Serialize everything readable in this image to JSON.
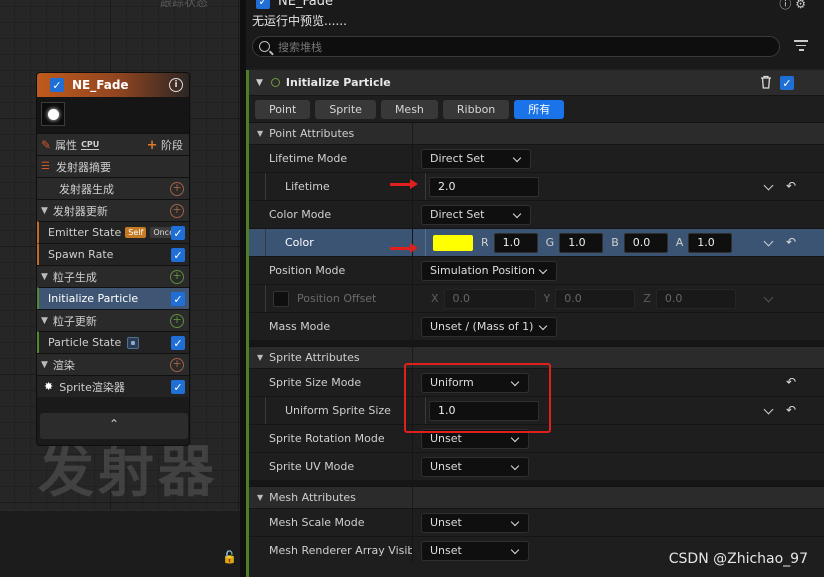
{
  "graph": {
    "top_clipped_text": "跟踪状态",
    "watermark": "发射器",
    "node": {
      "title": "NE_Fade",
      "checked": true,
      "props_label": "属性",
      "cpu_badge": "CPU",
      "stage_label": "阶段",
      "rows": [
        {
          "kind": "section",
          "label": "发射器摘要",
          "icon": "list-icon"
        },
        {
          "kind": "subsection",
          "label": "发射器生成",
          "plus": "orange"
        },
        {
          "kind": "section",
          "label": "发射器更新",
          "plus": "orange"
        },
        {
          "kind": "module",
          "label": "Emitter State",
          "badges": [
            "Self",
            "Once"
          ],
          "accent": "orange",
          "checked": true
        },
        {
          "kind": "module",
          "label": "Spawn Rate",
          "accent": "orange",
          "checked": true
        },
        {
          "kind": "section",
          "label": "粒子生成",
          "plus": "green"
        },
        {
          "kind": "module",
          "label": "Initialize Particle",
          "accent": "green",
          "checked": true,
          "selected": true
        },
        {
          "kind": "section",
          "label": "粒子更新",
          "plus": "green"
        },
        {
          "kind": "module",
          "label": "Particle State",
          "accent": "green",
          "checked": true
        },
        {
          "kind": "section",
          "label": "渲染",
          "plus": "orange"
        },
        {
          "kind": "module",
          "label": "Sprite渲染器",
          "accent": "none",
          "checked": true,
          "icon": "sprite-renderer-icon"
        }
      ]
    }
  },
  "panel": {
    "emitter_name": "NE_Fade",
    "preview_text": "无运行中预览......",
    "search_placeholder": "搜索堆栈",
    "module_title": "Initialize Particle",
    "tabs": [
      "Point",
      "Sprite",
      "Mesh",
      "Ribbon",
      "所有"
    ],
    "active_tab": "所有",
    "point_section": "Point Attributes",
    "lifetime_mode_label": "Lifetime Mode",
    "lifetime_mode_value": "Direct Set",
    "lifetime_label": "Lifetime",
    "lifetime_value": "2.0",
    "color_mode_label": "Color Mode",
    "color_mode_value": "Direct Set",
    "color_label": "Color",
    "color_swatch": "#ffff00",
    "color_axes": {
      "r": "R",
      "g": "G",
      "b": "B",
      "a": "A"
    },
    "color_values": {
      "r": "1.0",
      "g": "1.0",
      "b": "0.0",
      "a": "1.0"
    },
    "position_mode_label": "Position Mode",
    "position_mode_value": "Simulation Position",
    "position_offset_label": "Position Offset",
    "position_axes": {
      "x": "X",
      "y": "Y",
      "z": "Z"
    },
    "position_offset": {
      "x": "0.0",
      "y": "0.0",
      "z": "0.0"
    },
    "mass_mode_label": "Mass Mode",
    "mass_mode_value": "Unset / (Mass of 1)",
    "sprite_section": "Sprite Attributes",
    "sprite_size_mode_label": "Sprite Size Mode",
    "sprite_size_mode_value": "Uniform",
    "uniform_sprite_size_label": "Uniform Sprite Size",
    "uniform_sprite_size_value": "1.0",
    "sprite_rotation_mode_label": "Sprite Rotation Mode",
    "sprite_rotation_mode_value": "Unset",
    "sprite_uv_mode_label": "Sprite UV Mode",
    "sprite_uv_mode_value": "Unset",
    "mesh_section": "Mesh Attributes",
    "mesh_scale_mode_label": "Mesh Scale Mode",
    "mesh_scale_mode_value": "Unset",
    "mesh_renderer_array_label": "Mesh Renderer Array Visibi",
    "mesh_renderer_array_value": "Unset"
  },
  "footer": {
    "credit": "CSDN @Zhichao_97"
  },
  "colors": {
    "accent_blue": "#1a73e8",
    "selection": "#3c5474",
    "annotation_red": "#e0201c",
    "emitter_orange": "#c05a1e",
    "module_green": "#4f7d2a"
  }
}
